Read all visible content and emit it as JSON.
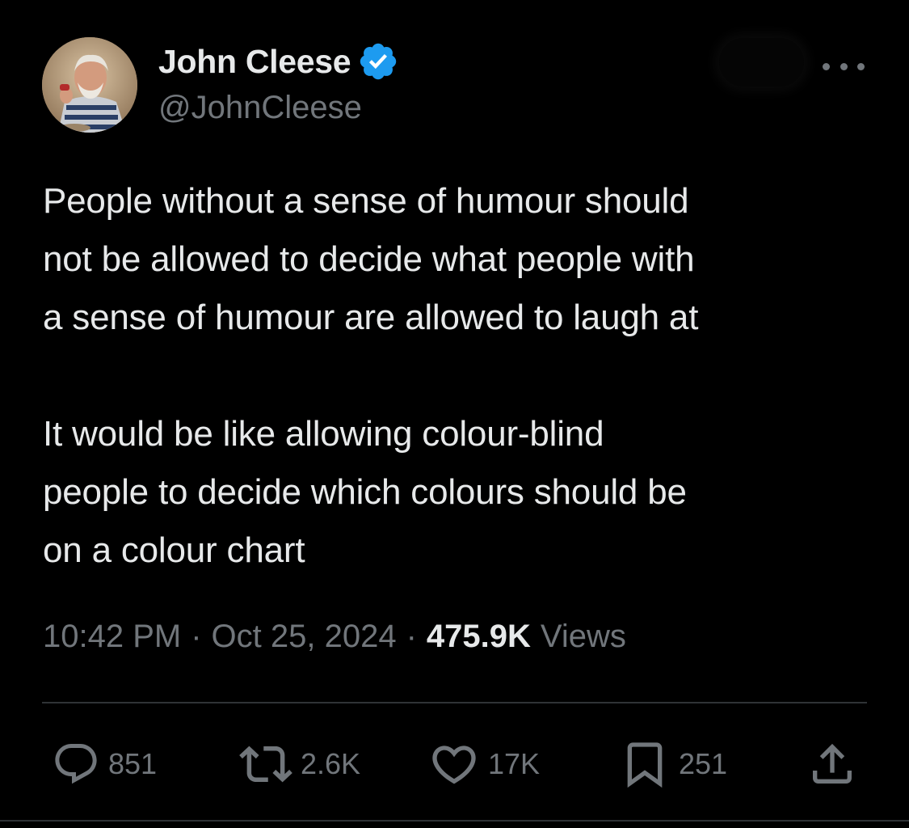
{
  "author": {
    "display_name": "John Cleese",
    "handle": "@JohnCleese",
    "verified_icon": "verified-badge-icon",
    "verified_color": "#1d9bf0"
  },
  "tweet": {
    "text": "People without a sense of humour should\nnot be allowed to decide what people with\na sense of humour are allowed to laugh at\n\nIt would be like allowing colour-blind\npeople to decide which colours should be\non a colour chart"
  },
  "meta": {
    "time": "10:42 PM",
    "separator": "·",
    "date": "Oct 25, 2024",
    "views_count": "475.9K",
    "views_label": "Views"
  },
  "actions": {
    "replies": "851",
    "reposts": "2.6K",
    "likes": "17K",
    "bookmarks": "251"
  },
  "colors": {
    "background": "#000000",
    "text_primary": "#e7e9ea",
    "text_secondary": "#71767b",
    "divider": "#2f3336"
  }
}
